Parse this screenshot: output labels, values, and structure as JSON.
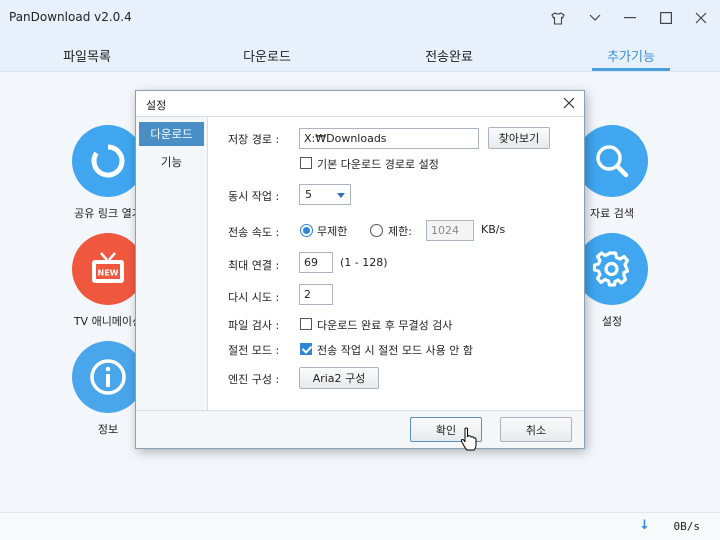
{
  "app": {
    "title": "PanDownload v2.0.4"
  },
  "tabs": [
    {
      "label": "파일목록"
    },
    {
      "label": "다운로드"
    },
    {
      "label": "전송완료"
    },
    {
      "label": "추가기능"
    }
  ],
  "features": {
    "share_link": "공유 링크 열기",
    "tv": "TV 애니메이션",
    "info": "정보",
    "search": "자료 검색",
    "settings": "설정"
  },
  "status": {
    "speed": "0B/s"
  },
  "dialog": {
    "title": "설정",
    "sidebar": [
      {
        "label": "다운로드"
      },
      {
        "label": "기능"
      }
    ],
    "save_path_label": "저장 경로 :",
    "save_path_value": "X:₩Downloads",
    "browse_button": "찾아보기",
    "default_path_checkbox": "기본 다운로드 경로로 설정",
    "concurrent_label": "동시 작업 :",
    "concurrent_value": "5",
    "speed_label": "전송 속도 :",
    "speed_unlimited": "무제한",
    "speed_limited": "제한:",
    "speed_limit_value": "1024",
    "speed_unit": "KB/s",
    "max_conn_label": "최대 연결 :",
    "max_conn_value": "69",
    "max_conn_range": "(1 - 128)",
    "retry_label": "다시 시도 :",
    "retry_value": "2",
    "file_check_label": "파일 검사 :",
    "file_check_checkbox": "다운로드 완료 후 무결성 검사",
    "power_label": "절전 모드 :",
    "power_checkbox": "전송 작업 시 절전 모드 사용 안 함",
    "engine_label": "엔진 구성 :",
    "engine_button": "Aria2 구성",
    "ok_button": "확인",
    "cancel_button": "취소"
  },
  "colors": {
    "accent": "#3a8fd8",
    "share_icon_bg": "#3fa6ef",
    "tv_icon_bg": "#f0573f",
    "info_icon_bg": "#4aa6ea"
  }
}
